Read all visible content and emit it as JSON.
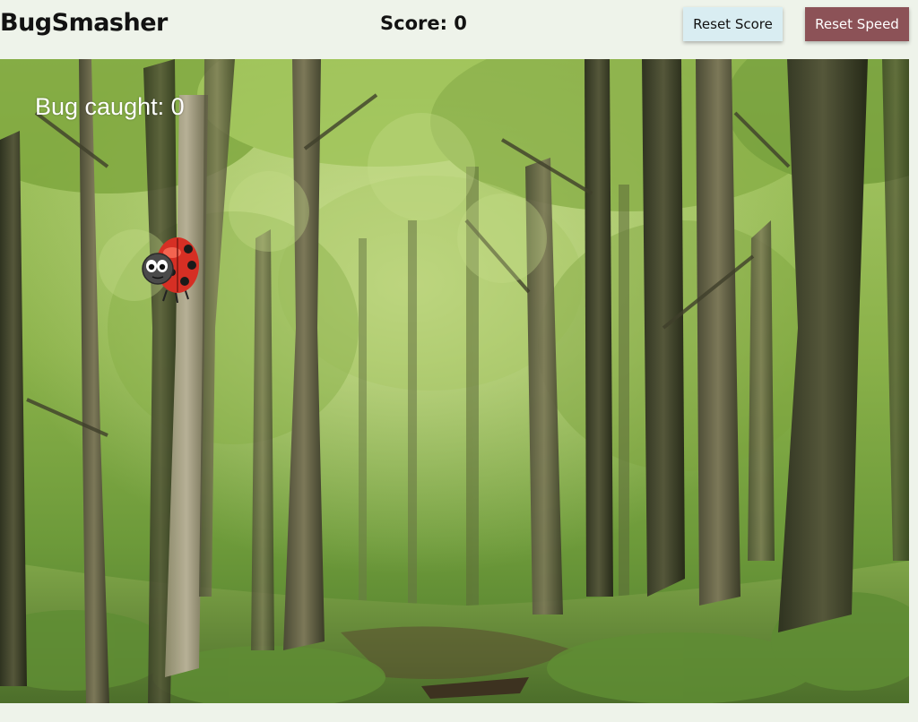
{
  "header": {
    "title": "BugSmasher",
    "score_text": "Score: 0",
    "reset_score_label": "Reset Score",
    "reset_speed_label": "Reset Speed"
  },
  "game": {
    "caught_text": "Bug caught: 0",
    "background": "forest",
    "bug": "ladybug"
  },
  "colors": {
    "page_bg": "#eef3ea",
    "reset_score_bg": "#d9edf2",
    "reset_speed_bg": "#8c5257",
    "caught_text": "#ffffff"
  }
}
